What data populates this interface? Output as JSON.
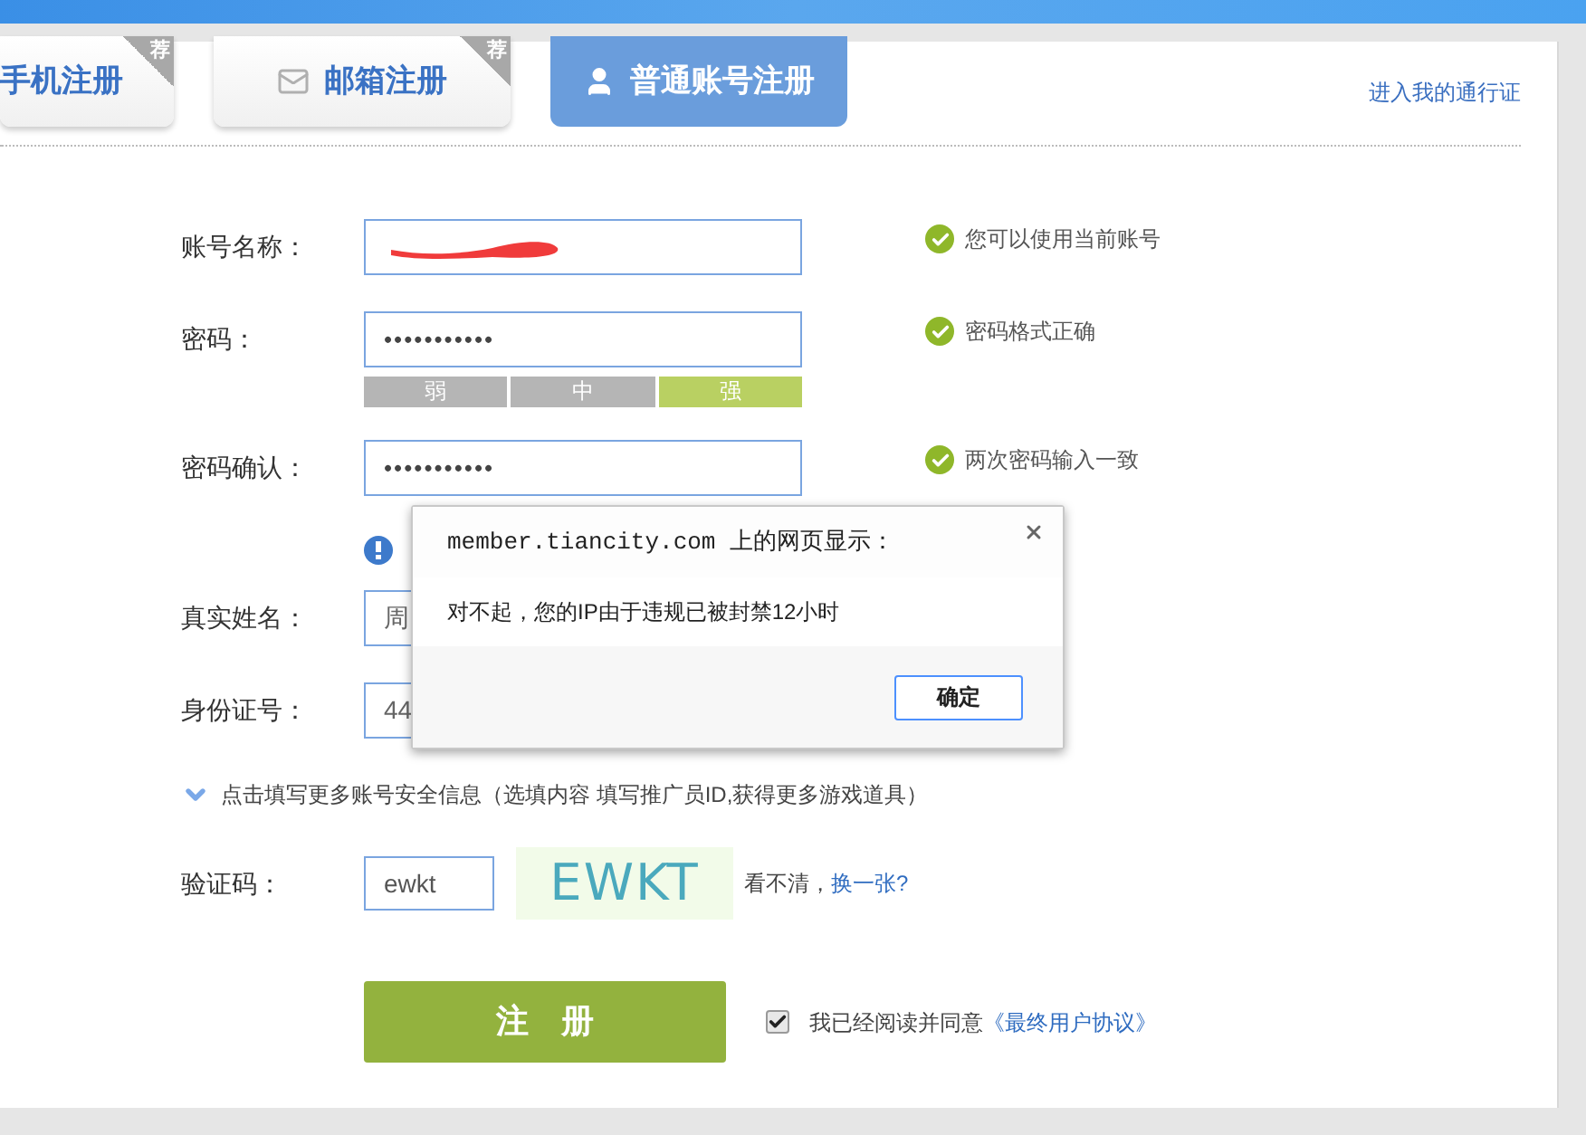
{
  "tabs": [
    {
      "label": "手机注册",
      "kind": "phone",
      "badge": "荐",
      "selected": false
    },
    {
      "label": "邮箱注册",
      "kind": "mail",
      "badge": "荐",
      "selected": false
    },
    {
      "label": "普通账号注册",
      "kind": "account",
      "selected": true
    }
  ],
  "passport_link": "进入我的通行证",
  "fields": [
    {
      "kind": "text",
      "label": "账号名称：",
      "redacted": true,
      "status": "您可以使用当前账号"
    },
    {
      "kind": "password",
      "label": "密码：",
      "value": "•••••••••••",
      "status": "密码格式正确",
      "strength": [
        {
          "label": "弱",
          "selected": false
        },
        {
          "label": "中",
          "selected": false
        },
        {
          "label": "强",
          "selected": true
        }
      ]
    },
    {
      "kind": "password",
      "label": "密码确认：",
      "value": "•••••••••••",
      "status": "两次密码输入一致"
    },
    {
      "kind": "notice"
    },
    {
      "kind": "text",
      "label": "真实姓名：",
      "value": "周"
    },
    {
      "kind": "text",
      "label": "身份证号：",
      "value": "44"
    }
  ],
  "more_info": {
    "label": "点击填写更多账号安全信息（选填内容 填写推广员ID,获得更多游戏道具）",
    "expanded": false
  },
  "captcha": {
    "label": "验证码：",
    "value": "ewkt",
    "image_text": "EWKT",
    "hint": "看不清，",
    "refresh_link": "换一张?"
  },
  "submit": "注　册",
  "agreement": {
    "checked": true,
    "text": "我已经阅读并同意",
    "link": "《最终用户协议》"
  },
  "dialog": {
    "title": "member.tiancity.com 上的网页显示：",
    "message": "对不起，您的IP由于违规已被封禁12小时",
    "ok": "确定"
  }
}
